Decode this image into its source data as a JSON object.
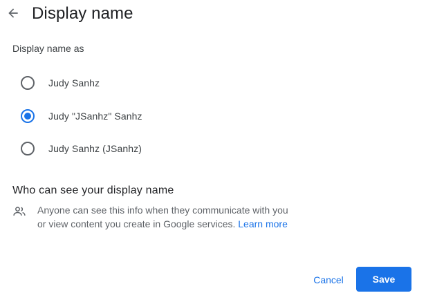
{
  "header": {
    "title": "Display name",
    "back_icon": "arrow-back-icon"
  },
  "display_as": {
    "label": "Display name as",
    "options": [
      {
        "label": "Judy Sanhz",
        "selected": false
      },
      {
        "label": "Judy \"JSanhz\" Sanhz",
        "selected": true
      },
      {
        "label": "Judy Sanhz (JSanhz)",
        "selected": false
      }
    ]
  },
  "visibility": {
    "heading": "Who can see your display name",
    "icon": "people-icon",
    "text": "Anyone can see this info when they communicate with you or view content you create in Google services.",
    "link": "Learn more"
  },
  "actions": {
    "cancel": "Cancel",
    "save": "Save"
  },
  "colors": {
    "accent": "#1a73e8",
    "text_primary": "#202124",
    "text_secondary": "#5f6368"
  }
}
